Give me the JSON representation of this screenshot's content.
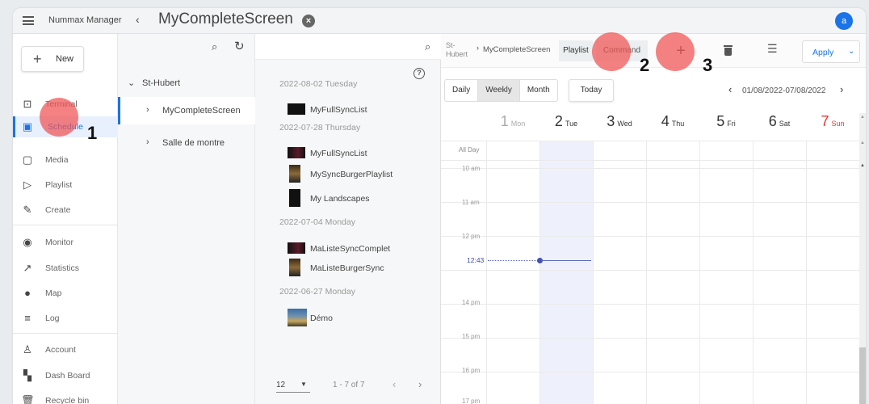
{
  "topbar": {
    "app_name": "Nummax Manager",
    "screen_title": "MyCompleteScreen",
    "avatar_initial": "a"
  },
  "sidebar": {
    "new_label": "New",
    "items": [
      {
        "label": "Terminal",
        "icon": "cast-icon"
      },
      {
        "label": "Schedule",
        "icon": "calendar-icon"
      },
      {
        "label": "Media",
        "icon": "image-icon"
      },
      {
        "label": "Playlist",
        "icon": "playlist-icon"
      },
      {
        "label": "Create",
        "icon": "pencil-icon"
      },
      {
        "label": "Monitor",
        "icon": "eye-icon"
      },
      {
        "label": "Statistics",
        "icon": "trending-icon"
      },
      {
        "label": "Map",
        "icon": "pin-icon"
      },
      {
        "label": "Log",
        "icon": "lines-icon"
      },
      {
        "label": "Account",
        "icon": "person-icon"
      },
      {
        "label": "Dash Board",
        "icon": "dashboard-icon"
      },
      {
        "label": "Recycle bin",
        "icon": "trash-icon"
      }
    ]
  },
  "tree": {
    "root": "St-Hubert",
    "children": [
      "MyCompleteScreen",
      "Salle de montre"
    ]
  },
  "playlists": {
    "groups": [
      {
        "date": "2022-08-02 Tuesday",
        "items": [
          "MyFullSyncList"
        ]
      },
      {
        "date": "2022-07-28 Thursday",
        "items": [
          "MyFullSyncList",
          "MySyncBurgerPlaylist",
          "My Landscapes"
        ]
      },
      {
        "date": "2022-07-04 Monday",
        "items": [
          "MaListeSyncComplet",
          "MaListeBurgerSync"
        ]
      },
      {
        "date": "2022-06-27 Monday",
        "items": [
          "Démo"
        ]
      }
    ],
    "page_size": "12",
    "range": "1 - 7 of 7"
  },
  "calendar": {
    "breadcrumb_root": "St-Hubert",
    "breadcrumb_leaf": "MyCompleteScreen",
    "tab_playlist": "Playlist",
    "tab_command": "Command",
    "add_symbol": "+",
    "apply_label": "Apply",
    "views": [
      "Daily",
      "Weekly",
      "Month"
    ],
    "active_view": "Weekly",
    "today_label": "Today",
    "range_label": "01/08/2022-07/08/2022",
    "days": [
      {
        "num": "1",
        "name": "Mon"
      },
      {
        "num": "2",
        "name": "Tue"
      },
      {
        "num": "3",
        "name": "Wed"
      },
      {
        "num": "4",
        "name": "Thu"
      },
      {
        "num": "5",
        "name": "Fri"
      },
      {
        "num": "6",
        "name": "Sat"
      },
      {
        "num": "7",
        "name": "Sun"
      }
    ],
    "all_day_label": "All Day",
    "hours": [
      "10 am",
      "11 am",
      "12 pm",
      "14 pm",
      "15 pm",
      "16 pm",
      "17 pm"
    ],
    "now_label": "12:43",
    "accent_color": "#1a73e8",
    "sunday_color": "#e53935"
  },
  "callouts": [
    "1",
    "2",
    "3"
  ]
}
